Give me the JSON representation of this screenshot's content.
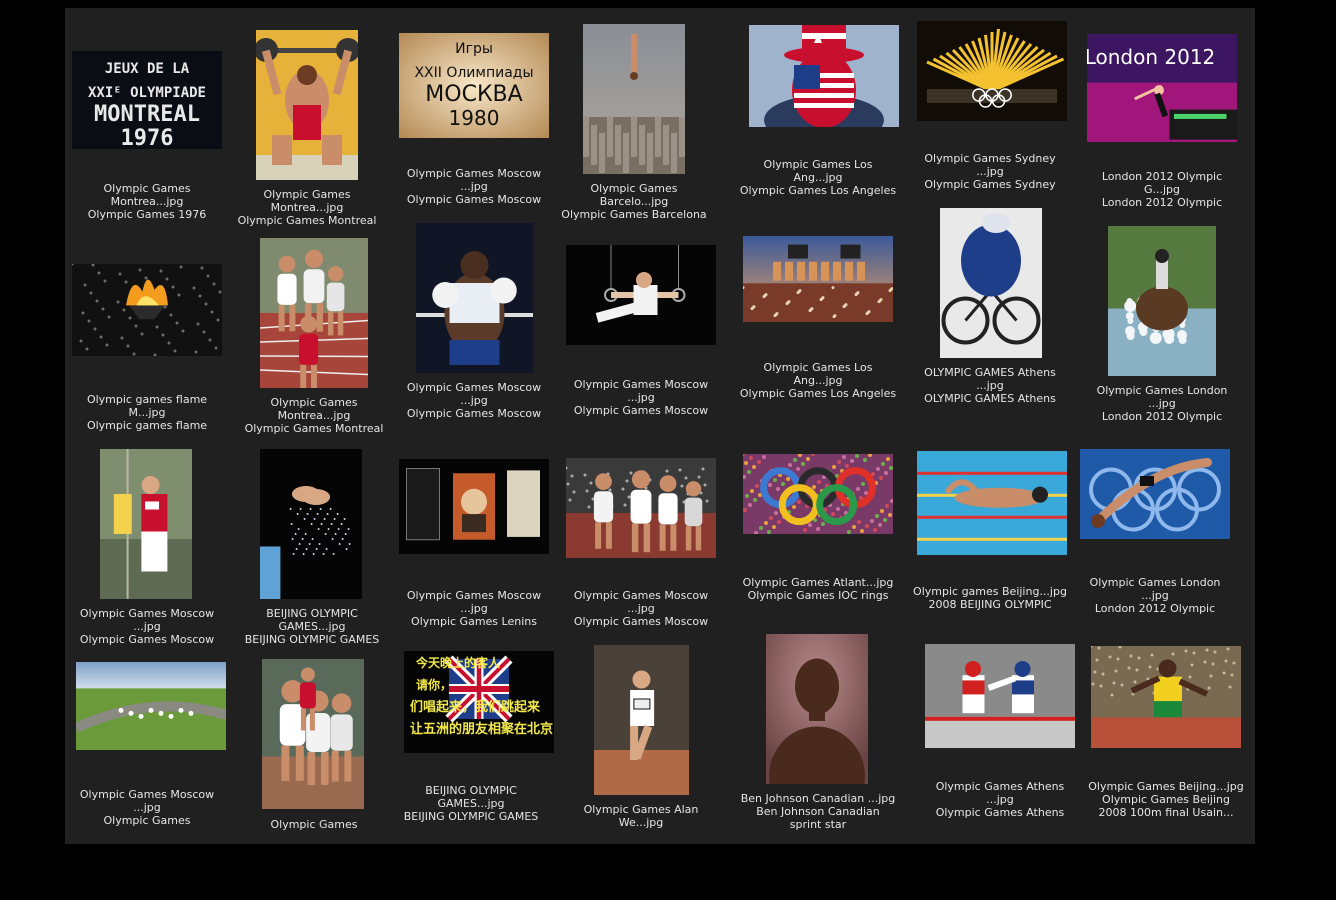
{
  "window": {
    "background_color": "#202020"
  },
  "items": [
    {
      "icon": "montreal-1976-poster-thumbnail",
      "lines": [
        "Olympic Games",
        "Montrea...jpg",
        "Olympic Games 1976"
      ]
    },
    {
      "icon": "weightlifter-thumbnail",
      "lines": [
        "Olympic Games",
        "Montrea...jpg",
        "Olympic Games Montreal"
      ]
    },
    {
      "icon": "moscow-1980-poster-thumbnail",
      "lines": [
        "Olympic Games Moscow",
        "...jpg",
        "Olympic Games Moscow"
      ]
    },
    {
      "icon": "barcelona-diver-thumbnail",
      "lines": [
        "Olympic Games",
        "Barcelo...jpg",
        "Olympic Games Barcelona"
      ]
    },
    {
      "icon": "usa-fan-thumbnail",
      "lines": [
        "Olympic Games Los",
        "Ang...jpg",
        "Olympic Games Los Angeles"
      ]
    },
    {
      "icon": "sydney-fireworks-thumbnail",
      "lines": [
        "Olympic Games Sydney",
        "...jpg",
        "Olympic Games Sydney"
      ]
    },
    {
      "icon": "london-2012-gymnast-thumbnail",
      "lines": [
        "London 2012 Olympic",
        "G...jpg",
        "London 2012 Olympic"
      ]
    },
    {
      "icon": "olympic-flame-thumbnail",
      "lines": [
        "Olympic games flame",
        "M...jpg",
        "Olympic games flame"
      ]
    },
    {
      "icon": "montreal-runners-thumbnail",
      "lines": [
        "Olympic Games",
        "Montrea...jpg",
        "Olympic Games Montreal"
      ]
    },
    {
      "icon": "boxer-thumbnail",
      "lines": [
        "Olympic Games Moscow",
        "...jpg",
        "Olympic Games Moscow"
      ]
    },
    {
      "icon": "rings-gymnast-thumbnail",
      "lines": [
        "Olympic Games Moscow",
        "...jpg",
        "Olympic Games Moscow"
      ]
    },
    {
      "icon": "la-coliseum-thumbnail",
      "lines": [
        "Olympic Games Los",
        "Ang...jpg",
        "Olympic Games Los Angeles"
      ]
    },
    {
      "icon": "track-cyclist-thumbnail",
      "lines": [
        "OLYMPIC GAMES Athens",
        "...jpg",
        "OLYMPIC GAMES Athens"
      ]
    },
    {
      "icon": "equestrian-water-thumbnail",
      "lines": [
        "Olympic Games London",
        "...jpg",
        "London 2012 Olympic"
      ]
    },
    {
      "icon": "javelin-athlete-thumbnail",
      "lines": [
        "Olympic Games Moscow",
        "...jpg",
        "Olympic Games Moscow"
      ]
    },
    {
      "icon": "beijing-divers-thumbnail",
      "lines": [
        "BEIJING OLYMPIC",
        "GAMES...jpg",
        "BEIJING OLYMPIC GAMES"
      ]
    },
    {
      "icon": "lenin-portrait-thumbnail",
      "lines": [
        "Olympic Games Moscow",
        "...jpg",
        "Olympic Games Lenins"
      ]
    },
    {
      "icon": "moscow-finish-line-thumbnail",
      "lines": [
        "Olympic Games Moscow",
        "...jpg",
        "Olympic Games Moscow"
      ]
    },
    {
      "icon": "flower-rings-thumbnail",
      "lines": [
        "Olympic Games Atlant...jpg",
        "Olympic Games IOC rings"
      ]
    },
    {
      "icon": "swimmer-thumbnail",
      "lines": [
        "Olympic games Beijing...jpg",
        "2008 BEIJING OLYMPIC"
      ]
    },
    {
      "icon": "diver-rings-thumbnail",
      "lines": [
        "Olympic Games London",
        "...jpg",
        "London 2012 Olympic"
      ]
    },
    {
      "icon": "cycling-road-thumbnail",
      "lines": [
        "Olympic Games Moscow",
        "...jpg",
        "Olympic Games"
      ]
    },
    {
      "icon": "distance-runners-thumbnail",
      "lines": [
        "Olympic Games"
      ]
    },
    {
      "icon": "beijing-banner-thumbnail",
      "lines": [
        "BEIJING OLYMPIC",
        "GAMES...jpg",
        "BEIJING OLYMPIC GAMES"
      ],
      "overlay": [
        "今天晚上的客人",
        "请你，",
        "们唱起来，我们跳起来",
        "让五洲的朋友相聚在北京"
      ]
    },
    {
      "icon": "runner-290-thumbnail",
      "lines": [
        "Olympic Games Alan",
        "We...jpg"
      ]
    },
    {
      "icon": "ben-johnson-thumbnail",
      "lines": [
        "Ben Johnson Canadian ...jpg",
        "Ben Johnson Canadian",
        "sprint star"
      ]
    },
    {
      "icon": "taekwondo-thumbnail",
      "lines": [
        "Olympic Games Athens",
        "...jpg",
        "Olympic Games Athens"
      ]
    },
    {
      "icon": "usain-bolt-thumbnail",
      "lines": [
        "Olympic Games Beijing...jpg",
        "Olympic Games Beijing",
        "2008 100m final Usain..."
      ]
    }
  ],
  "poster_text": {
    "montreal": [
      "JEUX DE LA",
      "XXIᴱ OLYMPIADE",
      "MONTREAL",
      "1976"
    ],
    "moscow": [
      "Игры",
      "XXII Олимпиады",
      "МОСКВА",
      "1980"
    ],
    "london": [
      "London 2012"
    ]
  }
}
